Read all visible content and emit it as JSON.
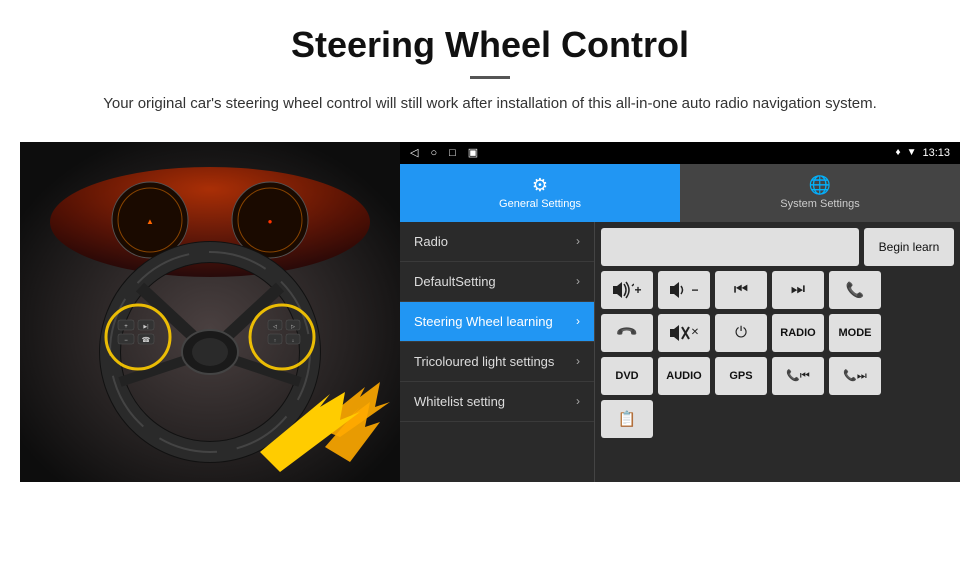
{
  "header": {
    "title": "Steering Wheel Control",
    "subtitle": "Your original car's steering wheel control will still work after installation of this all-in-one auto radio navigation system."
  },
  "status_bar": {
    "time": "13:13",
    "icons_left": [
      "◁",
      "○",
      "□",
      "▣"
    ],
    "icons_right": [
      "♥",
      "▼",
      "⊙"
    ]
  },
  "tabs": [
    {
      "id": "general",
      "label": "General Settings",
      "active": true
    },
    {
      "id": "system",
      "label": "System Settings",
      "active": false
    }
  ],
  "menu_items": [
    {
      "id": "radio",
      "label": "Radio",
      "active": false
    },
    {
      "id": "default-setting",
      "label": "DefaultSetting",
      "active": false
    },
    {
      "id": "steering-wheel",
      "label": "Steering Wheel learning",
      "active": true
    },
    {
      "id": "tricoloured",
      "label": "Tricoloured light settings",
      "active": false
    },
    {
      "id": "whitelist",
      "label": "Whitelist setting",
      "active": false
    }
  ],
  "control_panel": {
    "begin_learn": "Begin learn",
    "row1": {
      "blank": "",
      "button": "Begin learn"
    },
    "row2_icons": [
      "🔊+",
      "🔊−",
      "⏮",
      "⏭",
      "📞"
    ],
    "row3_icons": [
      "↩",
      "🔊✕",
      "⏻",
      "RADIO",
      "MODE"
    ],
    "row4_icons": [
      "DVD",
      "AUDIO",
      "GPS",
      "📞⏮",
      "📞⏭"
    ],
    "row5_icons": [
      "📋"
    ]
  },
  "colors": {
    "active_blue": "#2196F3",
    "bg_dark": "#2a2a2a",
    "bg_darker": "#1a1a1a",
    "btn_light": "#e0e0e0",
    "text_dark": "#111111"
  }
}
